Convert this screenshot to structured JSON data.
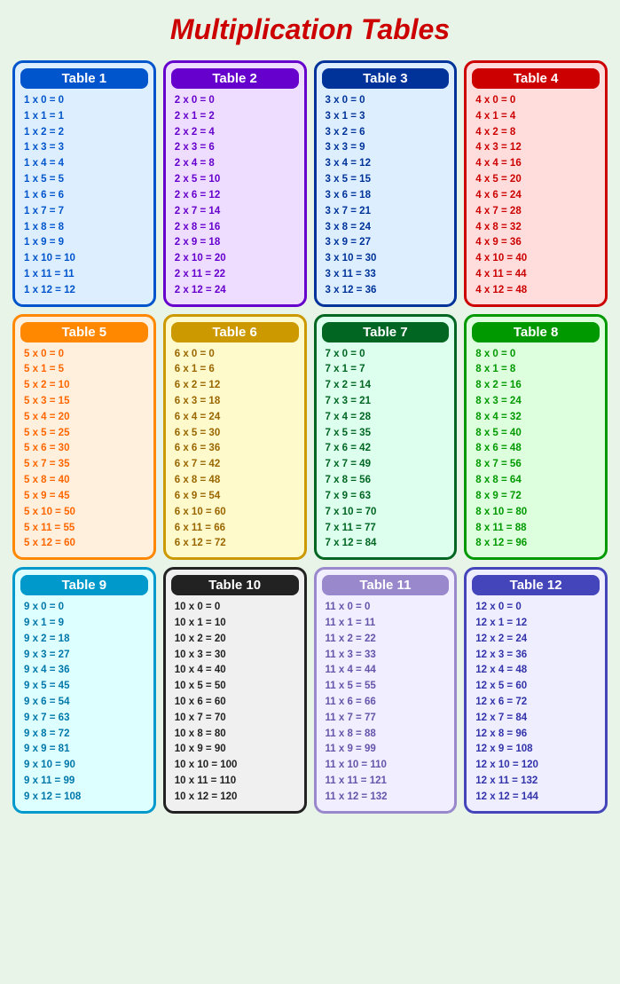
{
  "page": {
    "title": "Multiplication Tables"
  },
  "tables": [
    {
      "id": 1,
      "label": "Table 1",
      "rows": [
        "1  x  0  =  0",
        "1  x  1  =  1",
        "1  x  2  =  2",
        "1  x  3  =  3",
        "1  x  4  =  4",
        "1  x  5  =  5",
        "1  x  6  =  6",
        "1  x  7  =  7",
        "1  x  8  =  8",
        "1  x  9  =  9",
        "1  x  10  =  10",
        "1  x  11  =  11",
        "1  x  12  =  12"
      ]
    },
    {
      "id": 2,
      "label": "Table 2",
      "rows": [
        "2  x  0  =  0",
        "2  x  1  =  2",
        "2  x  2  =  4",
        "2  x  3  =  6",
        "2  x  4  =  8",
        "2  x  5  =  10",
        "2  x  6  =  12",
        "2  x  7  =  14",
        "2  x  8  =  16",
        "2  x  9  =  18",
        "2  x  10  =  20",
        "2  x  11  =  22",
        "2  x  12  =  24"
      ]
    },
    {
      "id": 3,
      "label": "Table 3",
      "rows": [
        "3  x  0  =  0",
        "3  x  1  =  3",
        "3  x  2  =  6",
        "3  x  3  =  9",
        "3  x  4  =  12",
        "3  x  5  =  15",
        "3  x  6  =  18",
        "3  x  7  =  21",
        "3  x  8  =  24",
        "3  x  9  =  27",
        "3  x  10  =  30",
        "3  x  11  =  33",
        "3  x  12  =  36"
      ]
    },
    {
      "id": 4,
      "label": "Table 4",
      "rows": [
        "4  x  0  =  0",
        "4  x  1  =  4",
        "4  x  2  =  8",
        "4  x  3  =  12",
        "4  x  4  =  16",
        "4  x  5  =  20",
        "4  x  6  =  24",
        "4  x  7  =  28",
        "4  x  8  =  32",
        "4  x  9  =  36",
        "4  x  10  =  40",
        "4  x  11  =  44",
        "4  x  12  =  48"
      ]
    },
    {
      "id": 5,
      "label": "Table 5",
      "rows": [
        "5  x  0  =  0",
        "5  x  1  =  5",
        "5  x  2  =  10",
        "5  x  3  =  15",
        "5  x  4  =  20",
        "5  x  5  =  25",
        "5  x  6  =  30",
        "5  x  7  =  35",
        "5  x  8  =  40",
        "5  x  9  =  45",
        "5  x  10  =  50",
        "5  x  11  =  55",
        "5  x  12  =  60"
      ]
    },
    {
      "id": 6,
      "label": "Table 6",
      "rows": [
        "6  x  0  =  0",
        "6  x  1  =  6",
        "6  x  2  =  12",
        "6  x  3  =  18",
        "6  x  4  =  24",
        "6  x  5  =  30",
        "6  x  6  =  36",
        "6  x  7  =  42",
        "6  x  8  =  48",
        "6  x  9  =  54",
        "6  x  10  =  60",
        "6  x  11  =  66",
        "6  x  12  =  72"
      ]
    },
    {
      "id": 7,
      "label": "Table 7",
      "rows": [
        "7  x  0  =  0",
        "7  x  1  =  7",
        "7  x  2  =  14",
        "7  x  3  =  21",
        "7  x  4  =  28",
        "7  x  5  =  35",
        "7  x  6  =  42",
        "7  x  7  =  49",
        "7  x  8  =  56",
        "7  x  9  =  63",
        "7  x  10  =  70",
        "7  x  11  =  77",
        "7  x  12  =  84"
      ]
    },
    {
      "id": 8,
      "label": "Table 8",
      "rows": [
        "8  x  0  =  0",
        "8  x  1  =  8",
        "8  x  2  =  16",
        "8  x  3  =  24",
        "8  x  4  =  32",
        "8  x  5  =  40",
        "8  x  6  =  48",
        "8  x  7  =  56",
        "8  x  8  =  64",
        "8  x  9  =  72",
        "8  x  10  =  80",
        "8  x  11  =  88",
        "8  x  12  =  96"
      ]
    },
    {
      "id": 9,
      "label": "Table 9",
      "rows": [
        "9  x  0  =  0",
        "9  x  1  =  9",
        "9  x  2  =  18",
        "9  x  3  =  27",
        "9  x  4  =  36",
        "9  x  5  =  45",
        "9  x  6  =  54",
        "9  x  7  =  63",
        "9  x  8  =  72",
        "9  x  9  =  81",
        "9  x  10  =  90",
        "9  x  11  =  99",
        "9  x  12  =  108"
      ]
    },
    {
      "id": 10,
      "label": "Table 10",
      "rows": [
        "10  x  0  =  0",
        "10  x  1  =  10",
        "10  x  2  =  20",
        "10  x  3  =  30",
        "10  x  4  =  40",
        "10  x  5  =  50",
        "10  x  6  =  60",
        "10  x  7  =  70",
        "10  x  8  =  80",
        "10  x  9  =  90",
        "10  x  10  =  100",
        "10  x  11  =  110",
        "10  x  12  =  120"
      ]
    },
    {
      "id": 11,
      "label": "Table 11",
      "rows": [
        "11  x  0  =  0",
        "11  x  1  =  11",
        "11  x  2  =  22",
        "11  x  3  =  33",
        "11  x  4  =  44",
        "11  x  5  =  55",
        "11  x  6  =  66",
        "11  x  7  =  77",
        "11  x  8  =  88",
        "11  x  9  =  99",
        "11  x  10  =  110",
        "11  x  11  =  121",
        "11  x  12  =  132"
      ]
    },
    {
      "id": 12,
      "label": "Table 12",
      "rows": [
        "12  x  0  =  0",
        "12  x  1  =  12",
        "12  x  2  =  24",
        "12  x  3  =  36",
        "12  x  4  =  48",
        "12  x  5  =  60",
        "12  x  6  =  72",
        "12  x  7  =  84",
        "12  x  8  =  96",
        "12  x  9  =  108",
        "12  x  10  =  120",
        "12  x  11  =  132",
        "12  x  12  =  144"
      ]
    }
  ]
}
